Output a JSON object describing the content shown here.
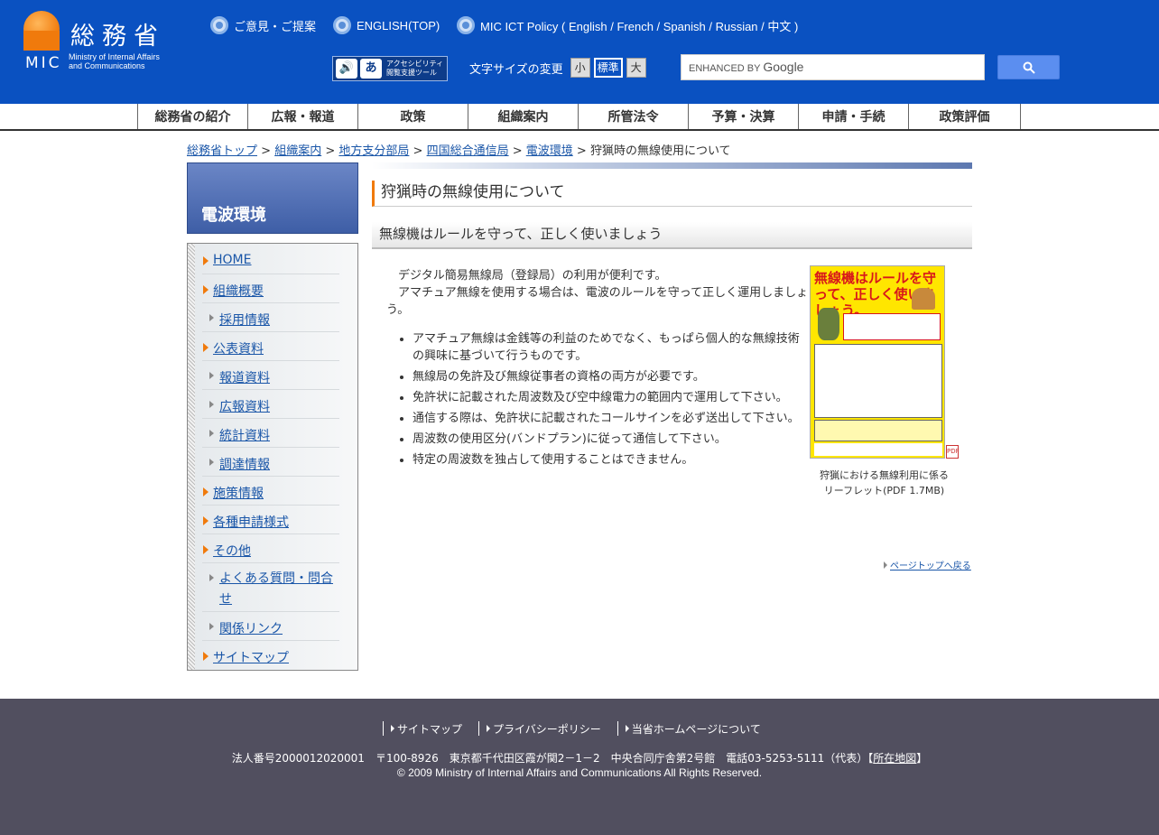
{
  "header": {
    "logo_jp": "総務省",
    "logo_mic": "MIC",
    "logo_en_line1": "Ministry of Internal Affairs",
    "logo_en_line2": "and Communications",
    "links": [
      "ご意見・ご提案",
      "ENGLISH(TOP)",
      "MIC ICT Policy ( English / French / Spanish / Russian / 中文 )"
    ],
    "a11y_line1": "アクセシビリティ",
    "a11y_line2": "閲覧支援ツール",
    "font_size_label": "文字サイズの変更",
    "font_sizes": [
      "小",
      "標準",
      "大"
    ],
    "search_placeholder_prefix": "ENHANCED BY",
    "search_placeholder_brand": "Google"
  },
  "gnav": [
    "総務省の紹介",
    "広報・報道",
    "政策",
    "組織案内",
    "所管法令",
    "予算・決算",
    "申請・手続",
    "政策評価"
  ],
  "breadcrumb": {
    "items": [
      "総務省トップ",
      "組織案内",
      "地方支分部局",
      "四国総合通信局",
      "電波環境"
    ],
    "current": "狩猟時の無線使用について",
    "sep": " > "
  },
  "sidebar": {
    "title": "電波環境",
    "items": [
      {
        "label": "HOME",
        "sub": false
      },
      {
        "label": "組織概要",
        "sub": false
      },
      {
        "label": "採用情報",
        "sub": true
      },
      {
        "label": "公表資料",
        "sub": false
      },
      {
        "label": "報道資料",
        "sub": true
      },
      {
        "label": "広報資料",
        "sub": true
      },
      {
        "label": "統計資料",
        "sub": true
      },
      {
        "label": "調達情報",
        "sub": true
      },
      {
        "label": "施策情報",
        "sub": false
      },
      {
        "label": "各種申請様式",
        "sub": false
      },
      {
        "label": "その他",
        "sub": false
      },
      {
        "label": "よくある質問・問合せ",
        "sub": true
      },
      {
        "label": "関係リンク",
        "sub": true
      },
      {
        "label": "サイトマップ",
        "sub": false
      }
    ]
  },
  "main": {
    "title": "狩猟時の無線使用について",
    "subtitle": "無線機はルールを守って、正しく使いましょう",
    "intro1": "デジタル簡易無線局（登録局）の利用が便利です。",
    "intro2": "アマチュア無線を使用する場合は、電波のルールを守って正しく運用しましょう。",
    "rules": [
      "アマチュア無線は金銭等の利益のためでなく、もっぱら個人的な無線技術の興味に基づいて行うものです。",
      "無線局の免許及び無線従事者の資格の両方が必要です。",
      "免許状に記載された周波数及び空中線電力の範囲内で運用して下さい。",
      "通信する際は、免許状に記載されたコールサインを必ず送出して下さい。",
      "周波数の使用区分(バンドプラン)に従って通信して下さい。",
      "特定の周波数を独占して使用することはできません。"
    ],
    "leaflet_headline": "無線機はルールを守って、正しく使いましょう。",
    "leaflet_caption_line1": "狩猟における無線利用に係る",
    "leaflet_caption_line2": "リーフレット(PDF 1.7MB)",
    "pdf_icon": "PDF",
    "page_top": "ページトップへ戻る"
  },
  "footer": {
    "links": [
      "サイトマップ",
      "プライバシーポリシー",
      "当省ホームページについて"
    ],
    "address_prefix": "法人番号2000012020001　〒100-8926　東京都千代田区霞が関2－1－2　中央合同庁舎第2号館　電話03-5253-5111（代表）【",
    "address_link": "所在地図",
    "address_suffix": "】",
    "copyright": "© 2009 Ministry of Internal Affairs and Communications All Rights Reserved."
  },
  "colors": {
    "header_blue": "#0a51c1",
    "accent_orange": "#f07a0c",
    "footer_bg": "#514f5f",
    "link": "#1a56a8"
  }
}
